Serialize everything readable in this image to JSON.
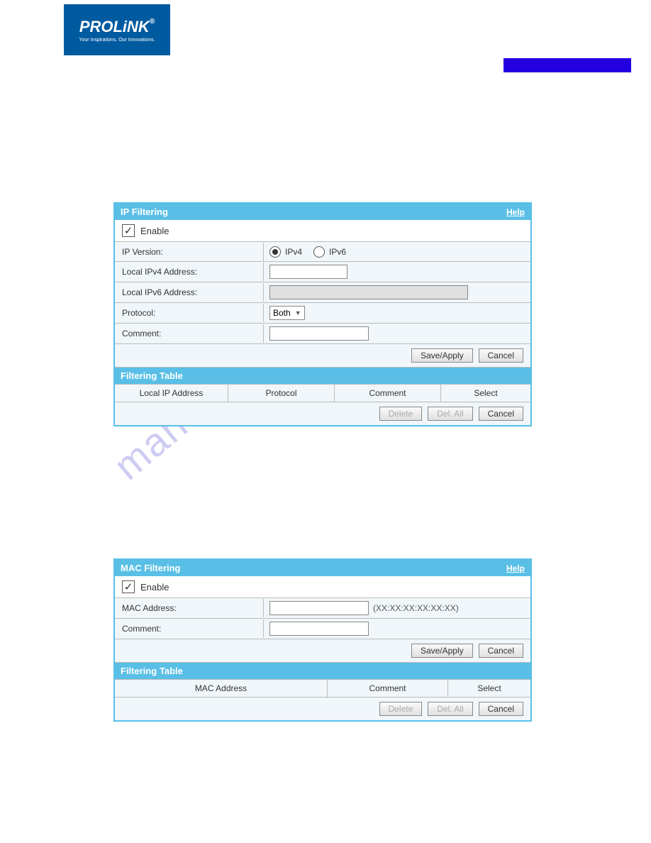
{
  "logo": {
    "brand": "PROLiNK",
    "reg": "®",
    "tagline": "Your Inspirations. Our Innovations."
  },
  "watermark": "manualshive.com",
  "panel1": {
    "title": "IP Filtering",
    "help": "Help",
    "enable_label": "Enable",
    "enable_checked": true,
    "rows": {
      "ip_version": {
        "label": "IP Version:",
        "opt1": "IPv4",
        "opt2": "IPv6",
        "selected": "IPv4"
      },
      "local_ipv4": {
        "label": "Local IPv4 Address:"
      },
      "local_ipv6": {
        "label": "Local IPv6 Address:"
      },
      "protocol": {
        "label": "Protocol:",
        "value": "Both"
      },
      "comment": {
        "label": "Comment:"
      }
    },
    "buttons": {
      "save": "Save/Apply",
      "cancel": "Cancel"
    },
    "table": {
      "title": "Filtering Table",
      "cols": {
        "c1": "Local IP Address",
        "c2": "Protocol",
        "c3": "Comment",
        "c4": "Select"
      },
      "btns": {
        "delete": "Delete",
        "delall": "Del. All",
        "cancel": "Cancel"
      }
    }
  },
  "panel2": {
    "title": "MAC Filtering",
    "help": "Help",
    "enable_label": "Enable",
    "enable_checked": true,
    "rows": {
      "mac": {
        "label": "MAC Address:",
        "hint": "(XX:XX:XX:XX:XX:XX)"
      },
      "comment": {
        "label": "Comment:"
      }
    },
    "buttons": {
      "save": "Save/Apply",
      "cancel": "Cancel"
    },
    "table": {
      "title": "Filtering Table",
      "cols": {
        "c1": "MAC Address",
        "c2": "Comment",
        "c3": "Select"
      },
      "btns": {
        "delete": "Delete",
        "delall": "Del. All",
        "cancel": "Cancel"
      }
    }
  }
}
